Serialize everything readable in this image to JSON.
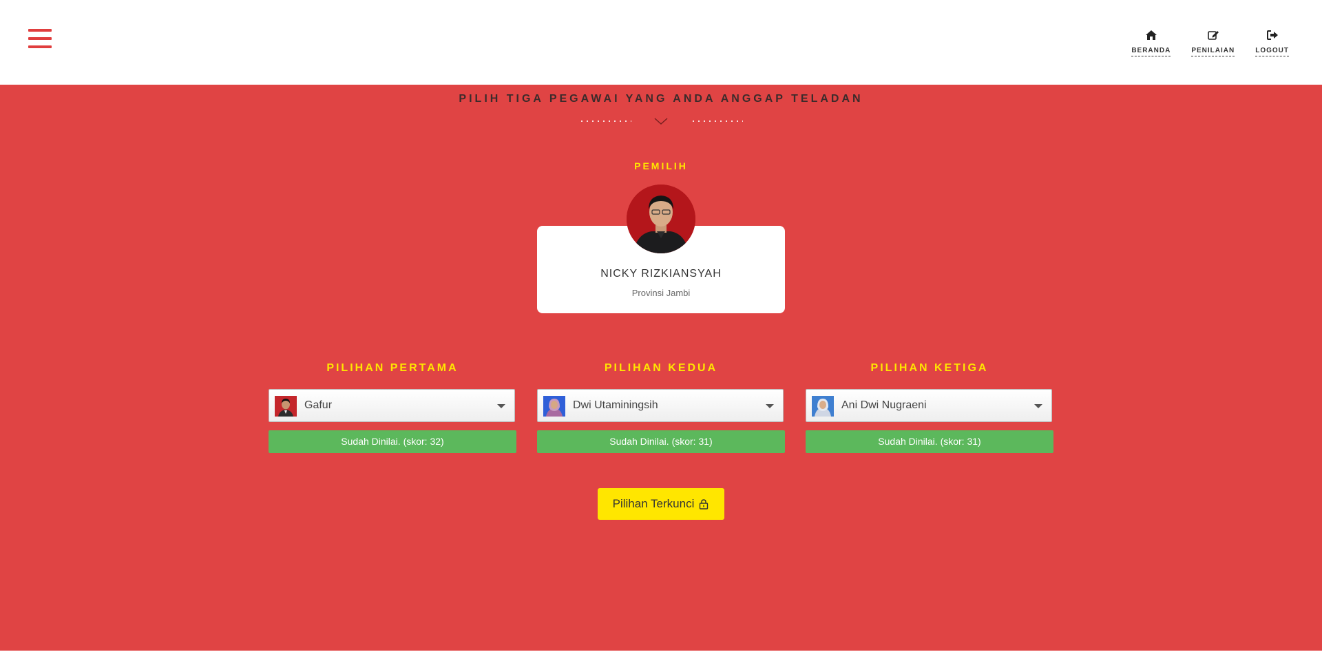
{
  "nav": {
    "items": [
      {
        "label": "BERANDA",
        "icon": "home-icon"
      },
      {
        "label": "PENILAIAN",
        "icon": "edit-icon"
      },
      {
        "label": "LOGOUT",
        "icon": "sign-out-icon"
      }
    ]
  },
  "heading": "PILIH TIGA PEGAWAI YANG ANDA ANGGAP TELADAN",
  "voter": {
    "label": "PEMILIH",
    "name": "NICKY RIZKIANSYAH",
    "region": "Provinsi Jambi"
  },
  "choices": [
    {
      "label": "PILIHAN PERTAMA",
      "selected": "Gafur",
      "status": "Sudah Dinilai. (skor: 32)"
    },
    {
      "label": "PILIHAN KEDUA",
      "selected": "Dwi Utaminingsih",
      "status": "Sudah Dinilai. (skor: 31)"
    },
    {
      "label": "PILIHAN KETIGA",
      "selected": "Ani Dwi Nugraeni",
      "status": "Sudah Dinilai. (skor: 31)"
    }
  ],
  "lock_button": {
    "label": "Pilihan Terkunci",
    "icon": "lock-icon"
  },
  "colors": {
    "background": "#e04444",
    "accent": "#ffe600",
    "success": "#5cb85c"
  }
}
